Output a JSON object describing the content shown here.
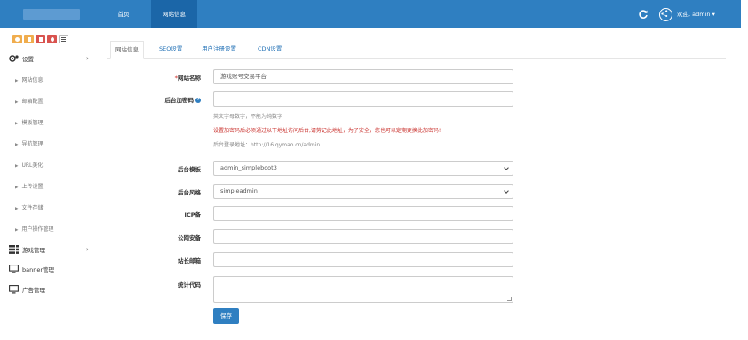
{
  "header": {
    "nav": [
      {
        "label": "首页"
      },
      {
        "label": "网站信息"
      }
    ],
    "welcome": "欢迎, admin ▾"
  },
  "sidebar": {
    "toolbar_colors": [
      "#f0ad4e",
      "#f0ad4e",
      "#d9534f",
      "#d9534f",
      "#ffffff"
    ],
    "settings": {
      "label": "设置",
      "arrow": "›"
    },
    "sub_items": [
      {
        "label": "网站信息"
      },
      {
        "label": "邮箱配置"
      },
      {
        "label": "模板管理"
      },
      {
        "label": "导航管理"
      },
      {
        "label": "URL美化"
      },
      {
        "label": "上传设置"
      },
      {
        "label": "文件存储"
      },
      {
        "label": "用户操作管理"
      }
    ],
    "game": {
      "label": "游戏管理",
      "arrow": "›"
    },
    "banner": {
      "label": "banner管理"
    },
    "ads": {
      "label": "广告管理"
    }
  },
  "tabs": [
    {
      "label": "网站信息"
    },
    {
      "label": "SEO设置"
    },
    {
      "label": "用户注册设置"
    },
    {
      "label": "CDN设置"
    }
  ],
  "form": {
    "site_name": {
      "required_mark": "*",
      "label": "网站名称",
      "value": "游戏账号交易平台"
    },
    "admin_code": {
      "label": "后台加密码",
      "value": ""
    },
    "help1": "英文字母数字，不能为纯数字",
    "help2": "设置加密码后必须通过以下地址访问后台,请劳记此地址，为了安全，您也可以定期更换此加密码!",
    "help3": "后台登录地址：http://16.qymao.cn/admin",
    "admin_theme": {
      "label": "后台模板",
      "value": "admin_simpleboot3"
    },
    "admin_style": {
      "label": "后台风格",
      "value": "simpleadmin"
    },
    "icp": {
      "label": "ICP备",
      "value": ""
    },
    "police": {
      "label": "公网安备",
      "value": ""
    },
    "email": {
      "label": "站长邮箱",
      "value": ""
    },
    "stats": {
      "label": "统计代码",
      "value": ""
    },
    "save_label": "保存"
  },
  "colors": {
    "primary": "#2f7fc1",
    "header": "#2f7fc1",
    "header_active": "#1b66a8",
    "warning": "#c9302c"
  }
}
